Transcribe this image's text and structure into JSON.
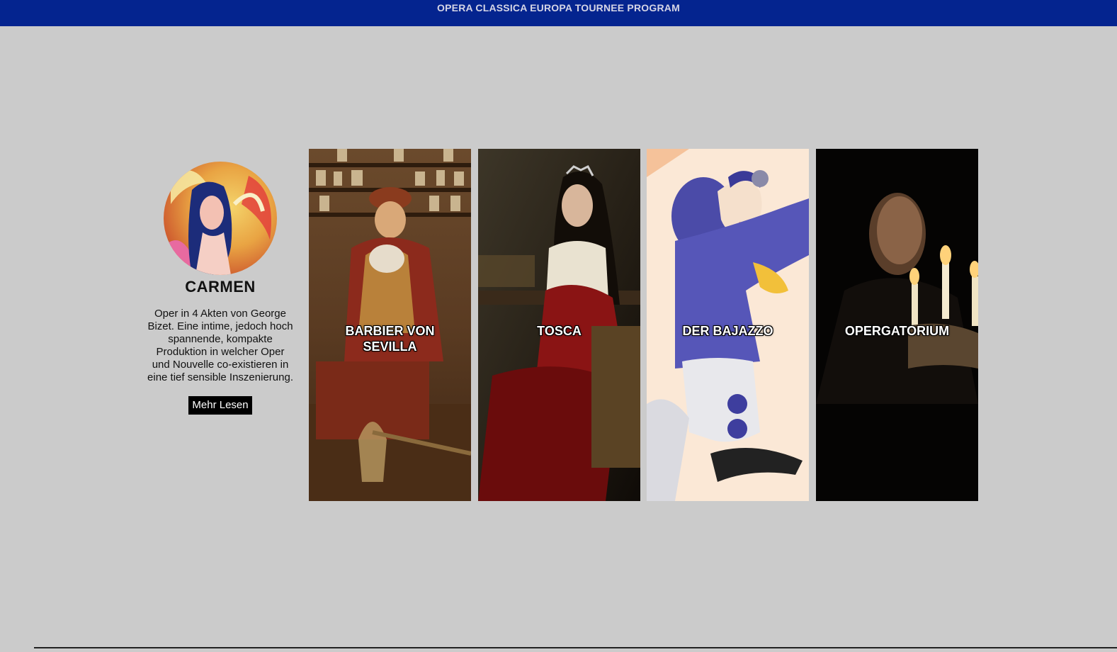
{
  "header": {
    "title": "OPERA CLASSICA EUROPA TOURNEE PROGRAM"
  },
  "featured": {
    "title": "CARMEN",
    "description": "Oper in 4 Akten von George Bizet. Eine intime, jedoch hoch spannende, kompakte Produktion in welcher Oper und Nouvelle co-existieren in eine tief sensible Inszenierung.",
    "button_label": "Mehr Lesen"
  },
  "cards": [
    {
      "label": "BARBIER VON SEVILLA"
    },
    {
      "label": "TOSCA"
    },
    {
      "label": "DER BAJAZZO"
    },
    {
      "label": "OPERGATORIUM"
    }
  ],
  "colors": {
    "header_bg": "#04248f",
    "page_bg": "#cbcbcb",
    "button_bg": "#000000"
  }
}
